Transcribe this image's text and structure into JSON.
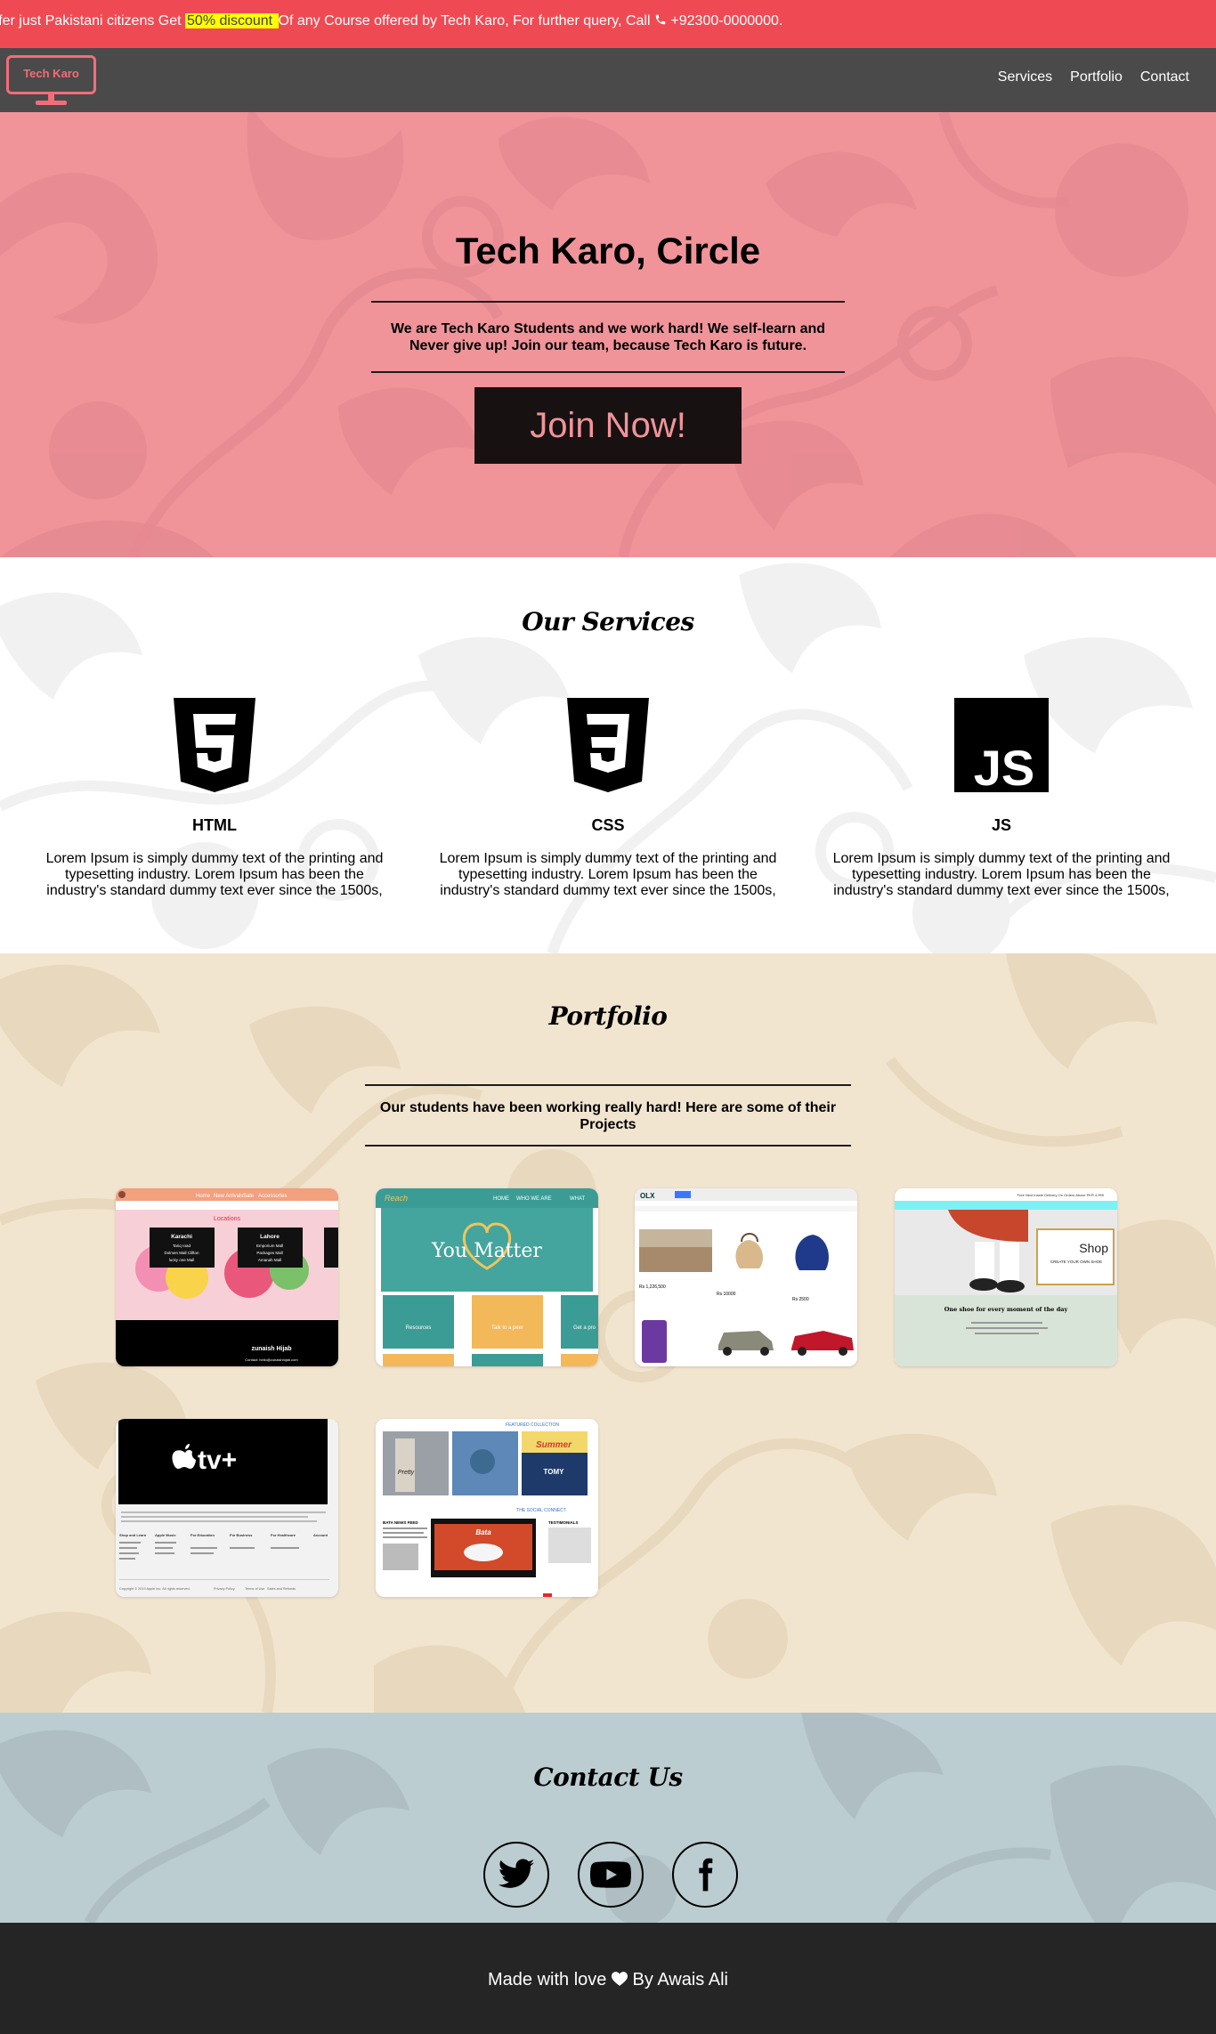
{
  "marquee": {
    "text_before": "ffer just Pakistani citizens Get ",
    "highlight": "50% discount ",
    "text_after": "Of any Course offered by Tech Karo, For further query, Call ",
    "phone": "+92300-0000000."
  },
  "navbar": {
    "logo_text": "Tech Karo",
    "links": [
      "Services",
      "Portfolio",
      "Contact"
    ]
  },
  "hero": {
    "title": "Tech Karo, Circle",
    "subtitle": "We are Tech Karo Students and we work hard! We self-learn and Never give up! Join our team, because Tech Karo is future.",
    "button": "Join Now!"
  },
  "services": {
    "title": "Our Services",
    "items": [
      {
        "name": "HTML",
        "icon": "html5-icon",
        "desc": "Lorem Ipsum is simply dummy text of the printing and typesetting industry. Lorem Ipsum has been the industry's standard dummy text ever since the 1500s,"
      },
      {
        "name": "CSS",
        "icon": "css3-icon",
        "desc": "Lorem Ipsum is simply dummy text of the printing and typesetting industry. Lorem Ipsum has been the industry's standard dummy text ever since the 1500s,"
      },
      {
        "name": "JS",
        "icon": "js-icon",
        "desc": "Lorem Ipsum is simply dummy text of the printing and typesetting industry. Lorem Ipsum has been the industry's standard dummy text ever since the 1500s,"
      }
    ]
  },
  "portfolio": {
    "title": "Portfolio",
    "subtitle": "Our students have been working really hard! Here are some of their Projects",
    "projects": {
      "p1": {
        "brand": "fashion-store",
        "nav": [
          "Home",
          "New Arrivals",
          "Sale",
          "Accessories"
        ],
        "heading": "Locations",
        "cities": [
          {
            "name": "Karachi",
            "lines": [
              "Tariq road",
              "Dolmen Mall Clifton",
              "lucky one Mall"
            ]
          },
          {
            "name": "Lahore",
            "lines": [
              "Emporium Mall",
              "Packages Mall",
              "Amanah Mall"
            ]
          }
        ],
        "footer": "zunaish Hijab",
        "contact": "Contact: hello@zunaishhijab.com"
      },
      "p2": {
        "nav": [
          "HOME",
          "WHO WE ARE",
          "WHAT"
        ],
        "hero": "You Matter",
        "tiles": [
          "Resources",
          "Talk to a peer",
          "Get a pro"
        ]
      },
      "p3": {
        "logo": "OLX",
        "prices": [
          "Rs 1,226,500",
          "Rs 10000",
          "Rs 2500"
        ]
      },
      "p4": {
        "promo": "Free Next Inside Delivery On Orders Above PKR 4,999",
        "heading": "Shop",
        "caption": "CREATE YOUR OWN SHOE",
        "tagline": "One shoe for every moment of the day"
      },
      "p5": {
        "logo": "tv+",
        "footer": "Copyright © 2019 Apple Inc. All rights reserved.",
        "cols": [
          "Shop and Learn",
          "Apple Music",
          "For Education",
          "For Business",
          "For Healthcare",
          "Account"
        ],
        "links": [
          "Privacy Policy",
          "Terms of Use",
          "Sales and Refunds"
        ]
      },
      "p6": {
        "featured": "FEATURED COLLECTION",
        "social": "THE SOCIAL CONNECT",
        "brand": "Bata",
        "summer": "Summer",
        "tomy": "TOMY",
        "news": "BATA NEWS FEED",
        "testimonials": "TESTIMONIALS"
      }
    }
  },
  "contact": {
    "title": "Contact Us",
    "social": [
      "twitter-icon",
      "youtube-icon",
      "facebook-icon"
    ]
  },
  "footer": {
    "text_before": "Made with love ",
    "text_after": " By Awais Ali"
  },
  "colors": {
    "marquee": "#ef4a53",
    "navbar": "#4a4a4a",
    "hero": "#f0949a",
    "portfolio": "#f2e5d0",
    "contact": "#bccdd1",
    "footer": "#252525"
  }
}
